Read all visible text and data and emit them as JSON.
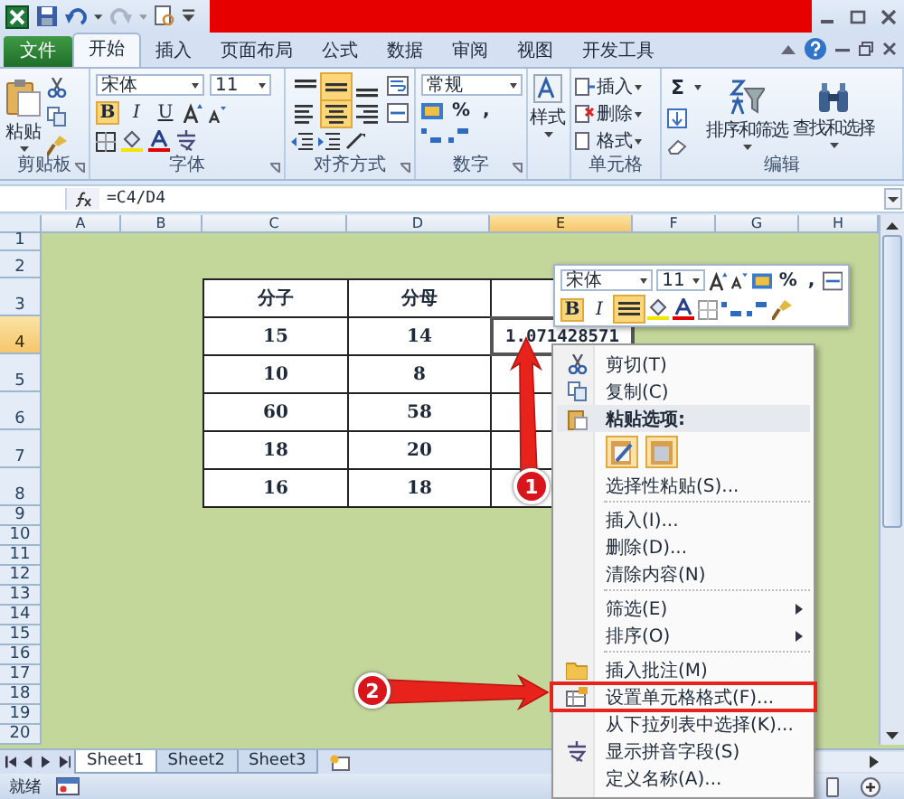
{
  "tabs": [
    {
      "label": "文件",
      "kind": "file",
      "selected": false
    },
    {
      "label": "开始",
      "kind": "tab",
      "selected": true
    },
    {
      "label": "插入",
      "kind": "tab",
      "selected": false
    },
    {
      "label": "页面布局",
      "kind": "tab",
      "selected": false
    },
    {
      "label": "公式",
      "kind": "tab",
      "selected": false
    },
    {
      "label": "数据",
      "kind": "tab",
      "selected": false
    },
    {
      "label": "审阅",
      "kind": "tab",
      "selected": false
    },
    {
      "label": "视图",
      "kind": "tab",
      "selected": false
    },
    {
      "label": "开发工具",
      "kind": "tab",
      "selected": false
    }
  ],
  "ribbon": {
    "paste_label": "粘贴",
    "font_name": "宋体",
    "font_size": "11",
    "font_buttons": [
      {
        "label": "B",
        "kind": "bold",
        "selected": true
      },
      {
        "label": "I",
        "kind": "italic",
        "selected": false
      },
      {
        "label": "U",
        "kind": "underline",
        "selected": false
      }
    ],
    "align_buttons": [
      {
        "kind": "top",
        "selected": false
      },
      {
        "kind": "middle",
        "selected": true
      },
      {
        "kind": "bottom",
        "selected": false
      },
      {
        "kind": "left",
        "selected": false
      },
      {
        "kind": "center",
        "selected": true
      },
      {
        "kind": "right",
        "selected": false
      }
    ],
    "number_format": "常规",
    "percent": "%",
    "comma": ",",
    "styles_label": "样式",
    "cell_buttons": [
      "插入",
      "删除",
      "格式"
    ],
    "sum": "Σ",
    "sort_label": "排序和筛选",
    "find_label": "查找和选择",
    "groups": [
      "剪贴板",
      "字体",
      "对齐方式",
      "数字",
      "单元格",
      "编辑"
    ]
  },
  "formula_bar": {
    "formula": "=C4/D4"
  },
  "columns": [
    {
      "label": "A",
      "selected": false
    },
    {
      "label": "B",
      "selected": false
    },
    {
      "label": "C",
      "selected": false
    },
    {
      "label": "D",
      "selected": false
    },
    {
      "label": "E",
      "selected": true
    },
    {
      "label": "F",
      "selected": false
    },
    {
      "label": "G",
      "selected": false
    },
    {
      "label": "H",
      "selected": false
    }
  ],
  "rows": [
    {
      "label": "1",
      "selected": false
    },
    {
      "label": "2",
      "selected": false
    },
    {
      "label": "3",
      "selected": false
    },
    {
      "label": "4",
      "selected": true
    },
    {
      "label": "5",
      "selected": false
    },
    {
      "label": "6",
      "selected": false
    },
    {
      "label": "7",
      "selected": false
    },
    {
      "label": "8",
      "selected": false
    },
    {
      "label": "9",
      "selected": false
    },
    {
      "label": "10",
      "selected": false
    },
    {
      "label": "11",
      "selected": false
    },
    {
      "label": "12",
      "selected": false
    },
    {
      "label": "13",
      "selected": false
    },
    {
      "label": "14",
      "selected": false
    },
    {
      "label": "15",
      "selected": false
    },
    {
      "label": "16",
      "selected": false
    },
    {
      "label": "17",
      "selected": false
    },
    {
      "label": "18",
      "selected": false
    },
    {
      "label": "19",
      "selected": false
    },
    {
      "label": "20",
      "selected": false
    }
  ],
  "table": [
    {
      "cells": [
        {
          "text": "分子",
          "selected": false
        },
        {
          "text": "分母",
          "selected": false
        }
      ]
    },
    {
      "cells": [
        {
          "text": "15",
          "selected": false
        },
        {
          "text": "14",
          "selected": false
        },
        {
          "text": "1.071428571",
          "selected": true
        }
      ]
    },
    {
      "cells": [
        {
          "text": "10",
          "selected": false
        },
        {
          "text": "8",
          "selected": false
        }
      ]
    },
    {
      "cells": [
        {
          "text": "60",
          "selected": false
        },
        {
          "text": "58",
          "selected": false
        }
      ]
    },
    {
      "cells": [
        {
          "text": "18",
          "selected": false
        },
        {
          "text": "20",
          "selected": false
        }
      ]
    },
    {
      "cells": [
        {
          "text": "16",
          "selected": false
        },
        {
          "text": "18",
          "selected": false
        }
      ]
    }
  ],
  "mini_toolbar": {
    "font_name": "宋体",
    "font_size": "11",
    "percent": "%",
    "comma": ",",
    "bold": "B",
    "italic": "I"
  },
  "menu": [
    {
      "kind": "item",
      "label": "剪切(T)",
      "submenu": false,
      "highlighted": false
    },
    {
      "kind": "item",
      "label": "复制(C)",
      "submenu": false,
      "highlighted": false
    },
    {
      "kind": "header",
      "label": "粘贴选项:",
      "submenu": false,
      "highlighted": false
    },
    {
      "kind": "paste_options"
    },
    {
      "kind": "item",
      "label": "选择性粘贴(S)...",
      "submenu": false,
      "highlighted": false
    },
    {
      "kind": "separator"
    },
    {
      "kind": "item",
      "label": "插入(I)...",
      "submenu": false,
      "highlighted": false
    },
    {
      "kind": "item",
      "label": "删除(D)...",
      "submenu": false,
      "highlighted": false
    },
    {
      "kind": "item",
      "label": "清除内容(N)",
      "submenu": false,
      "highlighted": false
    },
    {
      "kind": "separator"
    },
    {
      "kind": "item",
      "label": "筛选(E)",
      "submenu": true,
      "highlighted": false
    },
    {
      "kind": "item",
      "label": "排序(O)",
      "submenu": true,
      "highlighted": false
    },
    {
      "kind": "separator"
    },
    {
      "kind": "item",
      "label": "插入批注(M)",
      "submenu": false,
      "highlighted": false
    },
    {
      "kind": "item",
      "label": "设置单元格格式(F)...",
      "submenu": false,
      "highlighted": true
    },
    {
      "kind": "item",
      "label": "从下拉列表中选择(K)...",
      "submenu": false,
      "highlighted": false
    },
    {
      "kind": "item",
      "label": "显示拼音字段(S)",
      "submenu": false,
      "highlighted": false
    },
    {
      "kind": "item",
      "label": "定义名称(A)...",
      "submenu": false,
      "highlighted": false
    }
  ],
  "annotations": [
    "1",
    "2"
  ],
  "sheet_tabs": [
    {
      "label": "Sheet1",
      "selected": true
    },
    {
      "label": "Sheet2",
      "selected": false
    },
    {
      "label": "Sheet3",
      "selected": false
    }
  ],
  "status_bar": {
    "text": "就绪"
  }
}
